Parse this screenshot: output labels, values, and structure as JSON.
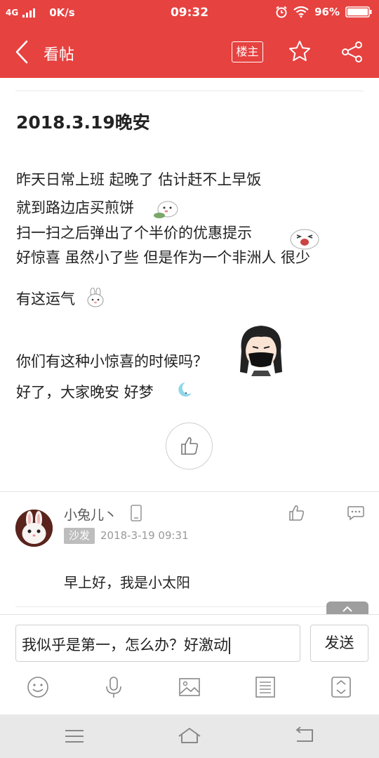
{
  "status_bar": {
    "network": "4G",
    "speed": "0K/s",
    "time": "09:32",
    "battery": "96%"
  },
  "header": {
    "title": "看帖",
    "louzhu_label": "楼主"
  },
  "post": {
    "title": "2018.3.19晚安",
    "lines": [
      "昨天日常上班 起晚了 估计赶不上早饭",
      "就到路边店买煎饼",
      "扫一扫之后弹出了个半价的优惠提示",
      "好惊喜 虽然小了些 但是作为一个非洲人 很少",
      "有这运气",
      "你们有这种小惊喜的时候吗？",
      "好了，大家晚安 好梦"
    ]
  },
  "comment": {
    "username": "小兔儿丶",
    "floor": "沙发",
    "time": "2018-3-19 09:31",
    "text": "早上好，我是小太阳"
  },
  "input": {
    "value": "我似乎是第一，怎么办？好激动",
    "send_label": "发送"
  },
  "colors": {
    "brand": "#e64240",
    "badge": "#bdbdbd"
  },
  "icons": [
    "back-arrow-icon",
    "star-icon",
    "share-icon",
    "thumbs-up-icon",
    "device-phone-icon",
    "comment-icon",
    "smile-icon",
    "mic-icon",
    "image-icon",
    "list-icon",
    "expand-icon",
    "menu-icon",
    "home-icon",
    "return-icon"
  ]
}
